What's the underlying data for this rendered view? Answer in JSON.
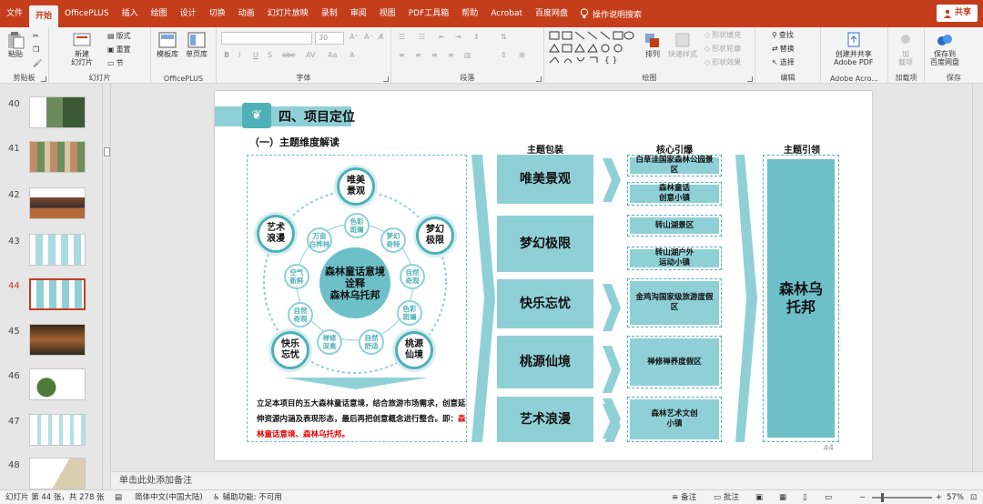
{
  "tabs": [
    "文件",
    "开始",
    "OfficePLUS",
    "插入",
    "绘图",
    "设计",
    "切换",
    "动画",
    "幻灯片放映",
    "录制",
    "审阅",
    "视图",
    "PDF工具箱",
    "帮助",
    "Acrobat",
    "百度网盘"
  ],
  "active_tab": "开始",
  "tell_me": "操作说明搜索",
  "share": "共享",
  "ribbon": {
    "clipboard": {
      "paste": "粘贴",
      "label": "剪贴板"
    },
    "slides": {
      "new_slide": "新建\n幻灯片",
      "layout": "版式",
      "reset": "重置",
      "section": "节",
      "label": "幻灯片"
    },
    "officeplus": {
      "template": "模板库",
      "single_page": "单页库",
      "label": "OfficePLUS"
    },
    "font": {
      "size": "30",
      "label": "字体"
    },
    "paragraph": {
      "label": "段落"
    },
    "drawing": {
      "arrange": "排列",
      "quick_styles": "快速样式",
      "fill": "形状填充",
      "outline": "形状轮廓",
      "effects": "形状效果",
      "label": "绘图"
    },
    "editing": {
      "find": "查找",
      "replace": "替换",
      "select": "选择",
      "label": "编辑"
    },
    "acrobat": {
      "create": "创建并共享\nAdobe PDF",
      "label": "Adobe Acro..."
    },
    "addins": {
      "load": "加\n载项",
      "label": "加载项"
    },
    "save": {
      "save_baidu": "保存到\n百度网盘",
      "label": "保存"
    }
  },
  "thumbnails": [
    {
      "num": "40"
    },
    {
      "num": "41"
    },
    {
      "num": "42"
    },
    {
      "num": "43"
    },
    {
      "num": "44",
      "selected": true
    },
    {
      "num": "45"
    },
    {
      "num": "46"
    },
    {
      "num": "47"
    },
    {
      "num": "48"
    }
  ],
  "slide": {
    "title": "四、项目定位",
    "subtitle": "（一）主题维度解读",
    "col_heads": {
      "package": "主题包装",
      "core": "核心引爆",
      "lead": "主题引领"
    },
    "center": "森林童话意境\n诠释\n森林乌托邦",
    "big_circles": [
      "唯美\n景观",
      "梦幻\n极限",
      "桃源\n仙境",
      "快乐\n忘忧",
      "艺术\n浪漫"
    ],
    "small_circles": [
      "色彩\n斑斓",
      "梦幻\n奇特",
      "自然\n奇观",
      "色彩\n斑斓",
      "自然\n舒适",
      "禅修\n深奥",
      "自然\n奇观",
      "空气\n新鲜",
      "万亩\n白桦林"
    ],
    "desc_plain": "立足本项目的五大森林童话意境，结合旅游市场需求，创意延伸资源内涵及表现形态，最后再把创意概念进行整合。即：",
    "desc_red": "森林童话意境、森林乌托邦。",
    "themes": [
      "唯美景观",
      "梦幻极限",
      "快乐忘忧",
      "桃源仙境",
      "艺术浪漫"
    ],
    "cores": [
      "白草洼国家森林公园景区",
      "森林童话\n创意小镇",
      "转山湖景区",
      "转山湖户外\n运动小镇",
      "金鸡沟国家级旅游度假区",
      "禅修禅养度假区",
      "森林艺术文创\n小镇"
    ],
    "lead": "森林乌\n托邦",
    "page_number": "44"
  },
  "notes_placeholder": "单击此处添加备注",
  "status": {
    "slide_info": "幻灯片 第 44 张，共 278 张",
    "language": "简体中文(中国大陆)",
    "accessibility": "辅助功能: 不可用",
    "notes": "备注",
    "comments": "批注",
    "zoom": "57%"
  },
  "colors": {
    "accent": "#c43e1c",
    "teal": "#8fd0d7",
    "teal_dark": "#4fb0b8"
  }
}
